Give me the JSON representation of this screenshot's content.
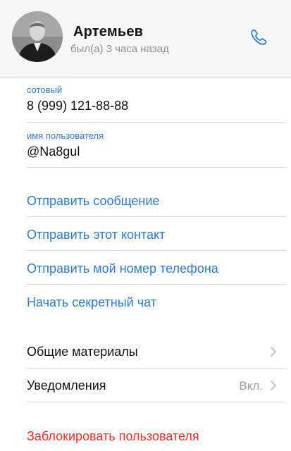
{
  "contact": {
    "name": "Артемьев",
    "status": "был(а) 3 часа назад"
  },
  "icons": {
    "call": "phone-icon",
    "chevron": "chevron-right-icon"
  },
  "fields": {
    "phone_label": "сотовый",
    "phone_value": "8 (999) 121-88-88",
    "username_label": "имя пользователя",
    "username_value": "@Na8gul"
  },
  "actions": {
    "send_message": "Отправить сообщение",
    "share_contact": "Отправить этот контакт",
    "share_my_phone": "Отправить мой номер телефона",
    "start_secret_chat": "Начать секретный чат"
  },
  "settings": {
    "shared_media_label": "Общие материалы",
    "notifications_label": "Уведомления",
    "notifications_value": "Вкл."
  },
  "danger": {
    "block_user": "Заблокировать пользователя"
  },
  "colors": {
    "accent": "#2f7bd0",
    "danger": "#e5322d",
    "secondary_text": "#8e8e93"
  }
}
